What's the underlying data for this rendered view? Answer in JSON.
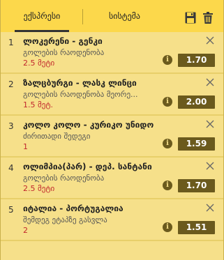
{
  "tabs": {
    "express": "ექსპრესი",
    "system": "სისტემა"
  },
  "icons": {
    "save": "save-icon",
    "trash": "trash-icon",
    "info": "i",
    "close": "close-icon"
  },
  "colors": {
    "tab_bar": "#fcd84b",
    "panel": "#f6e08a",
    "odds_bg": "#6b5a1d",
    "pick_red": "#c1272d"
  },
  "bets": [
    {
      "num": "1",
      "title": "ლოკერენი - გენკი",
      "market": "გოლების რაოდენობა",
      "pick": "2.5 მეტი",
      "odds": "1.70"
    },
    {
      "num": "2",
      "title": "ზალცბურგი - ლასკ ლინცი",
      "market": "გოლების რაოდენობა მეორე...",
      "pick": "1.5 მეტ.",
      "odds": "2.00"
    },
    {
      "num": "3",
      "title": "კოლო კოლო - კურიკო უნიდო",
      "market": "ძირითადი შედეგი",
      "pick": "1",
      "odds": "1.59"
    },
    {
      "num": "4",
      "title": "ოლიმპია(პარ) - დეპ. სანტანი",
      "market": "გოლების რაოდენობა",
      "pick": "2.5 მეტი",
      "odds": "1.70"
    },
    {
      "num": "5",
      "title": "იტალია - პორტუგალია",
      "market": "შემდეგ ეტაპზე გასვლა",
      "pick": "2",
      "odds": "1.51"
    }
  ]
}
